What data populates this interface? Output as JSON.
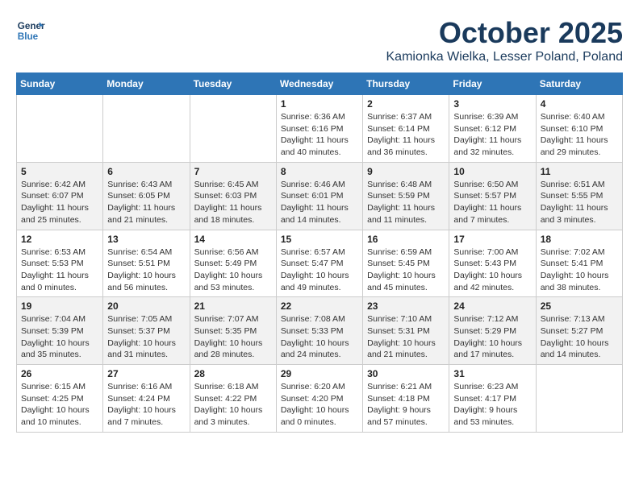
{
  "logo": {
    "line1": "General",
    "line2": "Blue"
  },
  "title": "October 2025",
  "subtitle": "Kamionka Wielka, Lesser Poland, Poland",
  "days_of_week": [
    "Sunday",
    "Monday",
    "Tuesday",
    "Wednesday",
    "Thursday",
    "Friday",
    "Saturday"
  ],
  "weeks": [
    [
      {
        "day": "",
        "info": ""
      },
      {
        "day": "",
        "info": ""
      },
      {
        "day": "",
        "info": ""
      },
      {
        "day": "1",
        "info": "Sunrise: 6:36 AM\nSunset: 6:16 PM\nDaylight: 11 hours\nand 40 minutes."
      },
      {
        "day": "2",
        "info": "Sunrise: 6:37 AM\nSunset: 6:14 PM\nDaylight: 11 hours\nand 36 minutes."
      },
      {
        "day": "3",
        "info": "Sunrise: 6:39 AM\nSunset: 6:12 PM\nDaylight: 11 hours\nand 32 minutes."
      },
      {
        "day": "4",
        "info": "Sunrise: 6:40 AM\nSunset: 6:10 PM\nDaylight: 11 hours\nand 29 minutes."
      }
    ],
    [
      {
        "day": "5",
        "info": "Sunrise: 6:42 AM\nSunset: 6:07 PM\nDaylight: 11 hours\nand 25 minutes."
      },
      {
        "day": "6",
        "info": "Sunrise: 6:43 AM\nSunset: 6:05 PM\nDaylight: 11 hours\nand 21 minutes."
      },
      {
        "day": "7",
        "info": "Sunrise: 6:45 AM\nSunset: 6:03 PM\nDaylight: 11 hours\nand 18 minutes."
      },
      {
        "day": "8",
        "info": "Sunrise: 6:46 AM\nSunset: 6:01 PM\nDaylight: 11 hours\nand 14 minutes."
      },
      {
        "day": "9",
        "info": "Sunrise: 6:48 AM\nSunset: 5:59 PM\nDaylight: 11 hours\nand 11 minutes."
      },
      {
        "day": "10",
        "info": "Sunrise: 6:50 AM\nSunset: 5:57 PM\nDaylight: 11 hours\nand 7 minutes."
      },
      {
        "day": "11",
        "info": "Sunrise: 6:51 AM\nSunset: 5:55 PM\nDaylight: 11 hours\nand 3 minutes."
      }
    ],
    [
      {
        "day": "12",
        "info": "Sunrise: 6:53 AM\nSunset: 5:53 PM\nDaylight: 11 hours\nand 0 minutes."
      },
      {
        "day": "13",
        "info": "Sunrise: 6:54 AM\nSunset: 5:51 PM\nDaylight: 10 hours\nand 56 minutes."
      },
      {
        "day": "14",
        "info": "Sunrise: 6:56 AM\nSunset: 5:49 PM\nDaylight: 10 hours\nand 53 minutes."
      },
      {
        "day": "15",
        "info": "Sunrise: 6:57 AM\nSunset: 5:47 PM\nDaylight: 10 hours\nand 49 minutes."
      },
      {
        "day": "16",
        "info": "Sunrise: 6:59 AM\nSunset: 5:45 PM\nDaylight: 10 hours\nand 45 minutes."
      },
      {
        "day": "17",
        "info": "Sunrise: 7:00 AM\nSunset: 5:43 PM\nDaylight: 10 hours\nand 42 minutes."
      },
      {
        "day": "18",
        "info": "Sunrise: 7:02 AM\nSunset: 5:41 PM\nDaylight: 10 hours\nand 38 minutes."
      }
    ],
    [
      {
        "day": "19",
        "info": "Sunrise: 7:04 AM\nSunset: 5:39 PM\nDaylight: 10 hours\nand 35 minutes."
      },
      {
        "day": "20",
        "info": "Sunrise: 7:05 AM\nSunset: 5:37 PM\nDaylight: 10 hours\nand 31 minutes."
      },
      {
        "day": "21",
        "info": "Sunrise: 7:07 AM\nSunset: 5:35 PM\nDaylight: 10 hours\nand 28 minutes."
      },
      {
        "day": "22",
        "info": "Sunrise: 7:08 AM\nSunset: 5:33 PM\nDaylight: 10 hours\nand 24 minutes."
      },
      {
        "day": "23",
        "info": "Sunrise: 7:10 AM\nSunset: 5:31 PM\nDaylight: 10 hours\nand 21 minutes."
      },
      {
        "day": "24",
        "info": "Sunrise: 7:12 AM\nSunset: 5:29 PM\nDaylight: 10 hours\nand 17 minutes."
      },
      {
        "day": "25",
        "info": "Sunrise: 7:13 AM\nSunset: 5:27 PM\nDaylight: 10 hours\nand 14 minutes."
      }
    ],
    [
      {
        "day": "26",
        "info": "Sunrise: 6:15 AM\nSunset: 4:25 PM\nDaylight: 10 hours\nand 10 minutes."
      },
      {
        "day": "27",
        "info": "Sunrise: 6:16 AM\nSunset: 4:24 PM\nDaylight: 10 hours\nand 7 minutes."
      },
      {
        "day": "28",
        "info": "Sunrise: 6:18 AM\nSunset: 4:22 PM\nDaylight: 10 hours\nand 3 minutes."
      },
      {
        "day": "29",
        "info": "Sunrise: 6:20 AM\nSunset: 4:20 PM\nDaylight: 10 hours\nand 0 minutes."
      },
      {
        "day": "30",
        "info": "Sunrise: 6:21 AM\nSunset: 4:18 PM\nDaylight: 9 hours\nand 57 minutes."
      },
      {
        "day": "31",
        "info": "Sunrise: 6:23 AM\nSunset: 4:17 PM\nDaylight: 9 hours\nand 53 minutes."
      },
      {
        "day": "",
        "info": ""
      }
    ]
  ]
}
